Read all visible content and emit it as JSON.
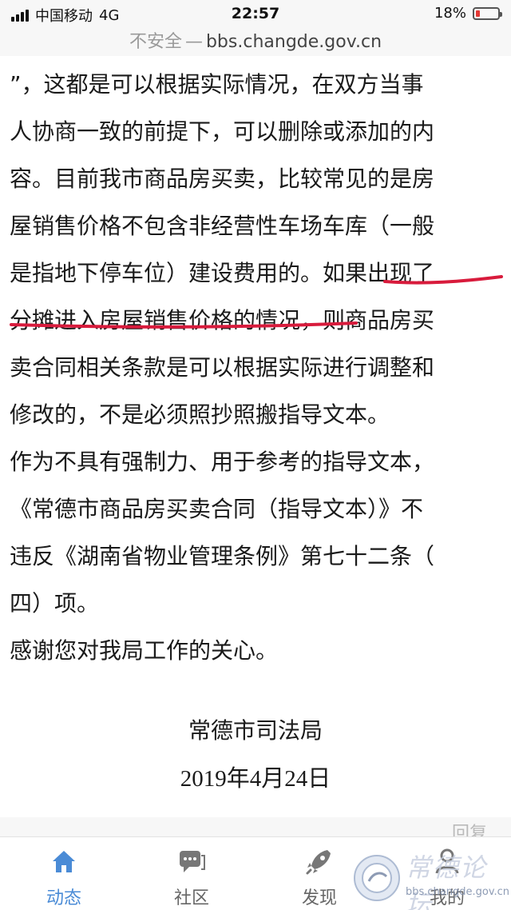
{
  "status_bar": {
    "carrier": "中国移动",
    "network": "4G",
    "time": "22:57",
    "battery": "18%",
    "battery_level": 0.18,
    "battery_color": "#e53935"
  },
  "url_bar": {
    "insecure_label": "不安全",
    "separator": "—",
    "domain": "bbs.changde.gov.cn"
  },
  "article": {
    "lines": [
      "”，这都是可以根据实际情况，在双方当事",
      "人协商一致的前提下，可以删除或添加的内",
      "容。目前我市商品房买卖，比较常见的是房",
      "屋销售价格不包含非经营性车场车库（一般",
      "是指地下停车位）建设费用的。如果出现了",
      "分摊进入房屋销售价格的情况，则商品房买",
      "卖合同相关条款是可以根据实际进行调整和",
      "修改的，不是必须照抄照搬指导文本。",
      "作为不具有强制力、用于参考的指导文本，",
      "《常德市商品房买卖合同（指导文本）》不",
      "违反《湖南省物业管理条例》第七十二条（",
      "四）项。",
      "感谢您对我局工作的关心。"
    ],
    "signature_org": "常德市司法局",
    "signature_date": "2019年4月24日",
    "annotation_color": "#d81b3c"
  },
  "reply_label": "回复",
  "tabs": [
    {
      "label": "动态",
      "icon": "home-icon",
      "active": true
    },
    {
      "label": "社区",
      "icon": "chat-icon",
      "active": false
    },
    {
      "label": "发现",
      "icon": "rocket-icon",
      "active": false
    },
    {
      "label": "我的",
      "icon": "user-icon",
      "active": false
    }
  ],
  "accent_color": "#4a8bd6",
  "watermark": {
    "title": "常德论坛",
    "url": "bbs.changde.gov.cn"
  }
}
